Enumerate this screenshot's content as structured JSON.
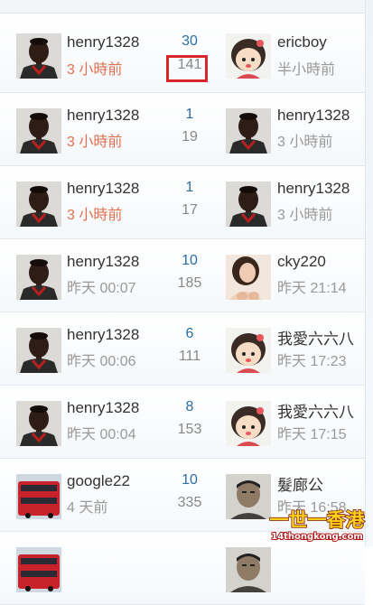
{
  "threads": [
    {
      "poster": {
        "name": "henry1328",
        "time": "3 小時前",
        "recent": true,
        "avatar": "soccer-player-avatar"
      },
      "replies": "30",
      "views": "141",
      "last": {
        "name": "ericboy",
        "time": "半小時前",
        "recent": false,
        "avatar": "cartoon-girl-avatar"
      }
    },
    {
      "poster": {
        "name": "henry1328",
        "time": "3 小時前",
        "recent": true,
        "avatar": "soccer-player-avatar"
      },
      "replies": "1",
      "views": "19",
      "last": {
        "name": "henry1328",
        "time": "3 小時前",
        "recent": false,
        "avatar": "soccer-player-avatar"
      }
    },
    {
      "poster": {
        "name": "henry1328",
        "time": "3 小時前",
        "recent": true,
        "avatar": "soccer-player-avatar"
      },
      "replies": "1",
      "views": "17",
      "last": {
        "name": "henry1328",
        "time": "3 小時前",
        "recent": false,
        "avatar": "soccer-player-avatar"
      }
    },
    {
      "poster": {
        "name": "henry1328",
        "time": "昨天 00:07",
        "recent": false,
        "avatar": "soccer-player-avatar"
      },
      "replies": "10",
      "views": "185",
      "last": {
        "name": "cky220",
        "time": "昨天 21:14",
        "recent": false,
        "avatar": "woman-photo-avatar"
      }
    },
    {
      "poster": {
        "name": "henry1328",
        "time": "昨天 00:06",
        "recent": false,
        "avatar": "soccer-player-avatar"
      },
      "replies": "6",
      "views": "111",
      "last": {
        "name": "我愛六六八",
        "time": "昨天 17:23",
        "recent": false,
        "avatar": "cartoon-girl-avatar"
      }
    },
    {
      "poster": {
        "name": "henry1328",
        "time": "昨天 00:04",
        "recent": false,
        "avatar": "soccer-player-avatar"
      },
      "replies": "8",
      "views": "153",
      "last": {
        "name": "我愛六六八",
        "time": "昨天 17:15",
        "recent": false,
        "avatar": "cartoon-girl-avatar"
      }
    },
    {
      "poster": {
        "name": "google22",
        "time": "4 天前",
        "recent": false,
        "avatar": "red-bus-avatar"
      },
      "replies": "10",
      "views": "335",
      "last": {
        "name": "髮廊公",
        "time": "昨天 16:58",
        "recent": false,
        "avatar": "man-photo-avatar"
      }
    },
    {
      "poster": {
        "name": "",
        "time": "",
        "recent": false,
        "avatar": "red-bus-avatar"
      },
      "replies": "",
      "views": "",
      "last": {
        "name": "",
        "time": "",
        "recent": false,
        "avatar": "man-photo-avatar"
      }
    }
  ],
  "watermark": {
    "brand": "一世一香港",
    "domain": "14thongkong.com"
  },
  "colors": {
    "recent_time": "#e0704f",
    "reply_count": "#2a6ea6",
    "highlight": "#d8262b"
  }
}
